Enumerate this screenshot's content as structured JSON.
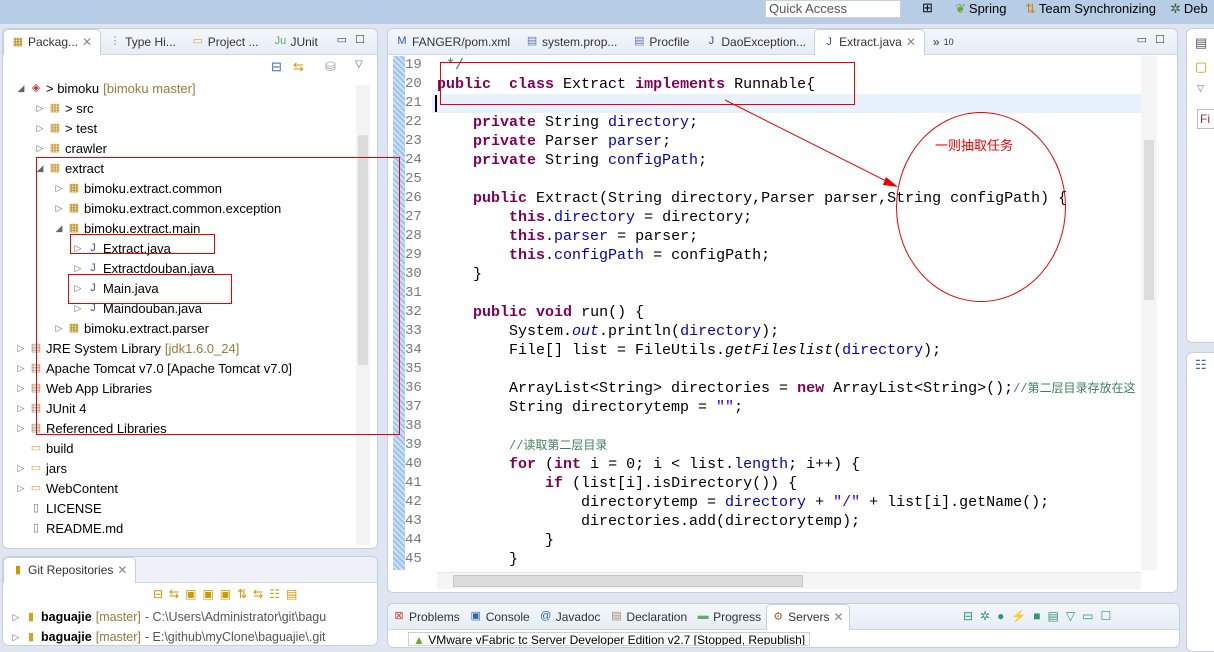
{
  "topbar": {
    "quick_access": "Quick Access",
    "perspectives": [
      {
        "label": "Spring",
        "icon": "spring-leaf-icon"
      },
      {
        "label": "Team Synchronizing",
        "icon": "sync-icon"
      },
      {
        "label": "Deb",
        "icon": "bug-icon"
      }
    ]
  },
  "package_explorer": {
    "tabs": [
      {
        "label": "Packag...",
        "icon": "package-icon",
        "active": true
      },
      {
        "label": "Type Hi...",
        "icon": "hierarchy-icon"
      },
      {
        "label": "Project ...",
        "icon": "folder-icon"
      },
      {
        "label": "JUnit",
        "icon": "junit-icon"
      }
    ],
    "tree": [
      {
        "level": 0,
        "tw": "◢",
        "label": "> bimoku",
        "dec": " [bimoku master]",
        "icon": "project-icon"
      },
      {
        "level": 1,
        "tw": "▷",
        "label": "> src",
        "icon": "source-folder-icon"
      },
      {
        "level": 1,
        "tw": "▷",
        "label": "> test",
        "icon": "source-folder-icon"
      },
      {
        "level": 1,
        "tw": "▷",
        "label": "crawler",
        "icon": "source-folder-icon"
      },
      {
        "level": 1,
        "tw": "◢",
        "label": "extract",
        "icon": "source-folder-icon"
      },
      {
        "level": 2,
        "tw": "▷",
        "label": "bimoku.extract.common",
        "icon": "package-icon"
      },
      {
        "level": 2,
        "tw": "▷",
        "label": "bimoku.extract.common.exception",
        "icon": "package-icon"
      },
      {
        "level": 2,
        "tw": "◢",
        "label": "bimoku.extract.main",
        "icon": "package-icon"
      },
      {
        "level": 3,
        "tw": "▷",
        "label": "Extract.java",
        "icon": "java-file-icon"
      },
      {
        "level": 3,
        "tw": "▷",
        "label": "Extractdouban.java",
        "icon": "java-file-icon"
      },
      {
        "level": 3,
        "tw": "▷",
        "label": "Main.java",
        "icon": "java-file-icon"
      },
      {
        "level": 3,
        "tw": "▷",
        "label": "Maindouban.java",
        "icon": "java-file-icon"
      },
      {
        "level": 2,
        "tw": "▷",
        "label": "bimoku.extract.parser",
        "icon": "package-icon"
      },
      {
        "level": 0,
        "tw": "▷",
        "label": "JRE System Library",
        "dec": " [jdk1.6.0_24]",
        "icon": "library-icon"
      },
      {
        "level": 0,
        "tw": "▷",
        "label": "Apache Tomcat v7.0 [Apache Tomcat v7.0]",
        "icon": "library-icon"
      },
      {
        "level": 0,
        "tw": "▷",
        "label": "Web App Libraries",
        "icon": "library-icon"
      },
      {
        "level": 0,
        "tw": "▷",
        "label": "JUnit 4",
        "icon": "library-icon"
      },
      {
        "level": 0,
        "tw": "▷",
        "label": "Referenced Libraries",
        "icon": "library-icon"
      },
      {
        "level": 0,
        "tw": "",
        "label": "build",
        "icon": "folder-icon"
      },
      {
        "level": 0,
        "tw": "▷",
        "label": "jars",
        "icon": "folder-icon"
      },
      {
        "level": 0,
        "tw": "▷",
        "label": "WebContent",
        "icon": "folder-icon"
      },
      {
        "level": 0,
        "tw": "",
        "label": "LICENSE",
        "icon": "file-icon"
      },
      {
        "level": 0,
        "tw": "",
        "label": "README.md",
        "icon": "file-icon"
      }
    ]
  },
  "git": {
    "tab": "Git Repositories",
    "repos": [
      {
        "name": "baguajie",
        "branch": " [master]",
        "path": " - C:\\Users\\Administrator\\git\\bagu"
      },
      {
        "name": "baguajie",
        "branch": " [master]",
        "path": " - E:\\github\\myClone\\baguajie\\.git"
      }
    ]
  },
  "editor": {
    "tabs": [
      {
        "label": "FANGER/pom.xml",
        "icon": "maven-icon"
      },
      {
        "label": "system.prop...",
        "icon": "properties-file-icon"
      },
      {
        "label": "Procfile",
        "icon": "text-file-icon"
      },
      {
        "label": "DaoException...",
        "icon": "java-file-icon"
      },
      {
        "label": "Extract.java",
        "icon": "java-file-icon",
        "active": true
      }
    ],
    "overflow": "»",
    "overflow_count": "10",
    "first_line": 19,
    "lines": [
      [
        [
          "cm",
          " */"
        ]
      ],
      [
        [
          "kw",
          "public"
        ],
        [
          "",
          "  "
        ],
        [
          "kw",
          "class"
        ],
        [
          "",
          " Extract "
        ],
        [
          "kw",
          "implements"
        ],
        [
          "",
          " Runnable{"
        ]
      ],
      [],
      [
        [
          "",
          "    "
        ],
        [
          "kw",
          "private"
        ],
        [
          "",
          " String "
        ],
        [
          "fd",
          "directory"
        ],
        [
          "",
          ";"
        ]
      ],
      [
        [
          "",
          "    "
        ],
        [
          "kw",
          "private"
        ],
        [
          "",
          " Parser "
        ],
        [
          "fd",
          "parser"
        ],
        [
          "",
          ";"
        ]
      ],
      [
        [
          "",
          "    "
        ],
        [
          "kw",
          "private"
        ],
        [
          "",
          " String "
        ],
        [
          "fd",
          "configPath"
        ],
        [
          "",
          ";"
        ]
      ],
      [],
      [
        [
          "",
          "    "
        ],
        [
          "kw",
          "public"
        ],
        [
          "",
          " Extract(String directory,Parser parser,String configPath) {"
        ]
      ],
      [
        [
          "",
          "        "
        ],
        [
          "kw",
          "this"
        ],
        [
          "",
          "."
        ],
        [
          "fd",
          "directory"
        ],
        [
          "",
          " = directory;"
        ]
      ],
      [
        [
          "",
          "        "
        ],
        [
          "kw",
          "this"
        ],
        [
          "",
          "."
        ],
        [
          "fd",
          "parser"
        ],
        [
          "",
          " = parser;"
        ]
      ],
      [
        [
          "",
          "        "
        ],
        [
          "kw",
          "this"
        ],
        [
          "",
          "."
        ],
        [
          "fd",
          "configPath"
        ],
        [
          "",
          " = configPath;"
        ]
      ],
      [
        [
          "",
          "    }"
        ]
      ],
      [],
      [
        [
          "",
          "    "
        ],
        [
          "kw",
          "public"
        ],
        [
          "",
          " "
        ],
        [
          "kw",
          "void"
        ],
        [
          "",
          " run() {"
        ]
      ],
      [
        [
          "",
          "        System."
        ],
        [
          "itf",
          "out"
        ],
        [
          "",
          ".println("
        ],
        [
          "fd",
          "directory"
        ],
        [
          "",
          ");"
        ]
      ],
      [
        [
          "",
          "        File[] list = FileUtils."
        ],
        [
          "it",
          "getFileslist"
        ],
        [
          "",
          "("
        ],
        [
          "fd",
          "directory"
        ],
        [
          "",
          ");"
        ]
      ],
      [],
      [
        [
          "",
          "        ArrayList<String> directories = "
        ],
        [
          "kw",
          "new"
        ],
        [
          "",
          " ArrayList<String>();"
        ],
        [
          "cm",
          "//第二层目录存放在这"
        ]
      ],
      [
        [
          "",
          "        String directorytemp = "
        ],
        [
          "st",
          "\"\""
        ],
        [
          "",
          ";"
        ]
      ],
      [],
      [
        [
          "",
          "        "
        ],
        [
          "cm",
          "//读取第二层目录"
        ]
      ],
      [
        [
          "",
          "        "
        ],
        [
          "kw",
          "for"
        ],
        [
          "",
          " ("
        ],
        [
          "kw",
          "int"
        ],
        [
          "",
          " i = 0; i < list."
        ],
        [
          "fd",
          "length"
        ],
        [
          "",
          "; i++) {"
        ]
      ],
      [
        [
          "",
          "            "
        ],
        [
          "kw",
          "if"
        ],
        [
          "",
          " (list[i].isDirectory()) {"
        ]
      ],
      [
        [
          "",
          "                directorytemp = "
        ],
        [
          "fd",
          "directory"
        ],
        [
          "",
          " + "
        ],
        [
          "st",
          "\"/\""
        ],
        [
          "",
          " + list[i].getName();"
        ]
      ],
      [
        [
          "",
          "                directories.add(directorytemp);"
        ]
      ],
      [
        [
          "",
          "            }"
        ]
      ],
      [
        [
          "",
          "        }"
        ]
      ]
    ],
    "annotation": "一则抽取任务"
  },
  "bottom": {
    "tabs": [
      {
        "label": "Problems",
        "icon": "problems-icon"
      },
      {
        "label": "Console",
        "icon": "console-icon"
      },
      {
        "label": "Javadoc",
        "icon": "at-icon"
      },
      {
        "label": "Declaration",
        "icon": "declaration-icon"
      },
      {
        "label": "Progress",
        "icon": "progress-icon"
      },
      {
        "label": "Servers",
        "icon": "servers-icon",
        "active": true
      }
    ],
    "server_row": "VMware vFabric tc Server Developer Edition v2.7  [Stopped, Republish]"
  },
  "colors": {
    "keyword": "#7f0055",
    "field": "#0000c0",
    "string": "#2a00ff",
    "comment": "#3f7f5f",
    "annotation": "#e00000"
  }
}
